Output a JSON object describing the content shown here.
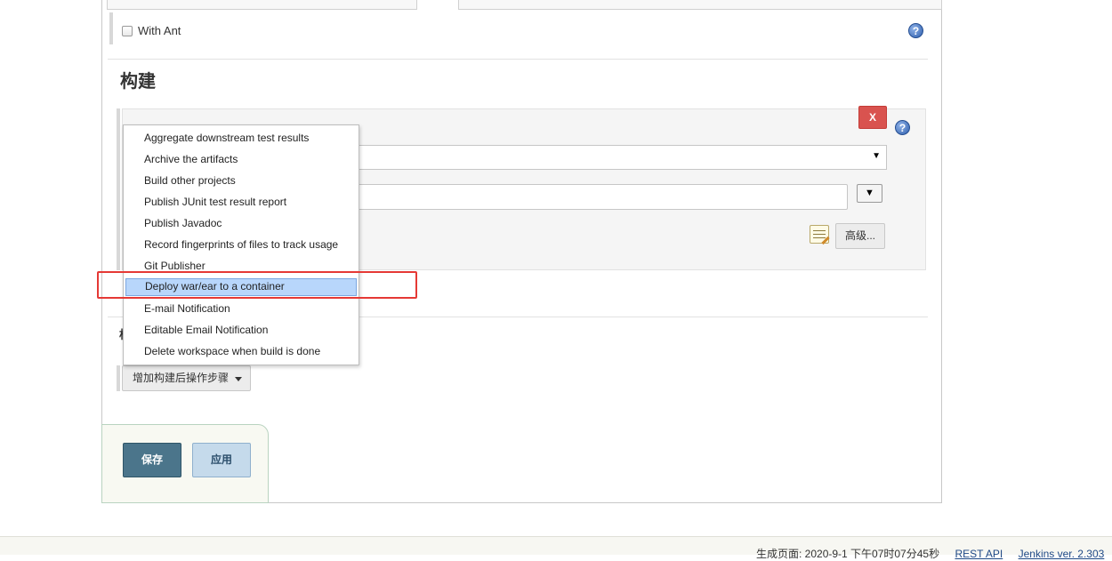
{
  "options": {
    "with_ant_label": "With Ant",
    "with_ant_checked": false
  },
  "build": {
    "section_title": "构建",
    "remove_button_label": "X",
    "select_caret": "▼",
    "dropdown_button_label": "▼",
    "advanced_button_label": "高级..."
  },
  "menu": {
    "items": [
      "Aggregate downstream test results",
      "Archive the artifacts",
      "Build other projects",
      "Publish JUnit test result report",
      "Publish Javadoc",
      "Record fingerprints of files to track usage",
      "Git Publisher",
      "Deploy war/ear to a container",
      "E-mail Notification",
      "Editable Email Notification",
      "Delete workspace when build is done"
    ],
    "selected_item": "Deploy war/ear to a container"
  },
  "post_build": {
    "section_title_stub": "构",
    "add_button_label": "增加构建后操作步骤"
  },
  "actions": {
    "save_label": "保存",
    "apply_label": "应用"
  },
  "footer": {
    "generated_text": "生成页面: 2020-9-1 下午07时07分45秒",
    "rest_api_label": "REST API",
    "version_text": "Jenkins ver. 2.303"
  },
  "colors": {
    "highlight": "#e53935",
    "selected_item_bg": "#b8d6fb",
    "save_button_bg": "#4b758b",
    "apply_button_bg": "#c5daeb",
    "remove_button_bg": "#d9534f"
  },
  "icons": {
    "help": "help-icon",
    "notepad": "notepad-icon",
    "caret": "chevron-down-icon"
  }
}
